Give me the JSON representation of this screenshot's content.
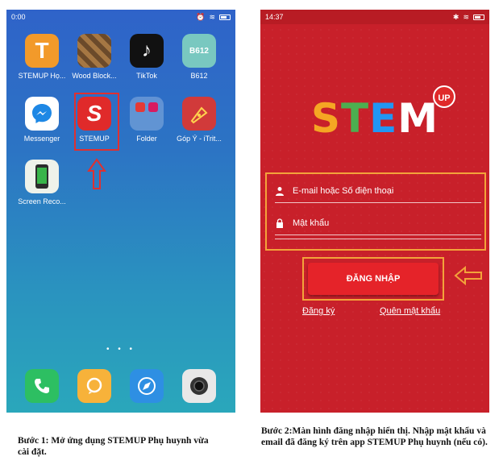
{
  "phone1": {
    "status": {
      "time": "0:00"
    },
    "apps": [
      {
        "label": "STEMUP Họ...",
        "icon": "t-letter-icon",
        "glyph": "T"
      },
      {
        "label": "Wood Block...",
        "icon": "wood-block-icon"
      },
      {
        "label": "TikTok",
        "icon": "tiktok-icon",
        "glyph": "♪"
      },
      {
        "label": "B612",
        "icon": "b612-icon",
        "glyph": "B612"
      },
      {
        "label": "Messenger",
        "icon": "messenger-icon"
      },
      {
        "label": "STEMUP",
        "icon": "stemup-icon",
        "glyph": "S"
      },
      {
        "label": "Folder",
        "icon": "folder-icon"
      },
      {
        "label": "Góp Ý - iTrit...",
        "icon": "pen-nib-icon"
      },
      {
        "label": "Screen Reco...",
        "icon": "screen-recorder-icon"
      }
    ],
    "page_dots": "• • •",
    "dock": [
      {
        "icon": "phone-icon"
      },
      {
        "icon": "chat-icon"
      },
      {
        "icon": "browser-icon"
      },
      {
        "icon": "camera-icon"
      }
    ]
  },
  "phone2": {
    "status": {
      "time": "14:37"
    },
    "logo_text": "STEM",
    "logo_badge": "UP",
    "email_placeholder": "E-mail hoặc Số điện thoại",
    "password_placeholder": "Mật khẩu",
    "login_button": "ĐĂNG NHẬP",
    "register_link": "Đăng ký",
    "forgot_link": "Quên mật khẩu"
  },
  "captions": {
    "step1": "Bước 1: Mở ứng dụng STEMUP Phụ huynh vừa cài đặt.",
    "step2": "Bước 2:Màn hình đăng nhập hiển thị. Nhập mật khẩu và email đã đăng ký trên app STEMUP Phụ huynh  (nếu có)."
  },
  "colors": {
    "highlight_red": "#e03030",
    "highlight_orange": "#f3a33a",
    "login_red": "#e52329",
    "bg_red": "#c8202a"
  }
}
